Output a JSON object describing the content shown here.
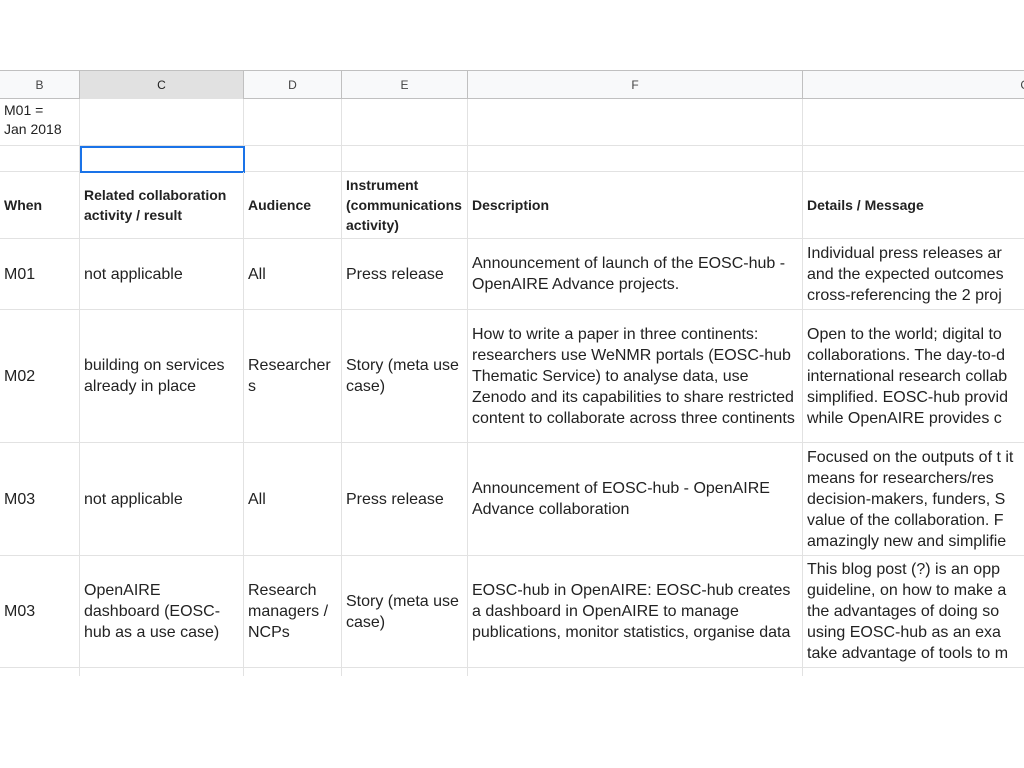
{
  "columns": [
    {
      "letter": "B"
    },
    {
      "letter": "C"
    },
    {
      "letter": "D"
    },
    {
      "letter": "E"
    },
    {
      "letter": "F"
    },
    {
      "letter": "G"
    }
  ],
  "top_note": "M01 =\nJan 2018",
  "headers": {
    "when": "When",
    "related": "Related collaboration activity / result",
    "audience": "Audience",
    "instrument": "Instrument (communications activity)",
    "description": "Description",
    "details": "Details / Message"
  },
  "rows": [
    {
      "when": "M01",
      "related": "not applicable",
      "audience": "All",
      "instrument": "Press release",
      "description": "Announcement of launch of the EOSC-hub - OpenAIRE Advance projects.",
      "details": "Individual press releases ar and the expected outcomes cross-referencing the 2 proj"
    },
    {
      "when": "M02",
      "related": "building on services already in place",
      "audience": "Researchers",
      "instrument": "Story (meta use case)",
      "description": "How to write a paper in three continents: researchers use WeNMR portals (EOSC-hub Thematic Service) to analyse data, use Zenodo and its capabilities to share restricted content to collaborate across three continents",
      "details": "Open to the world; digital to collaborations. The day-to-d international research collab simplified. EOSC-hub provid while OpenAIRE provides c"
    },
    {
      "when": "M03",
      "related": "not applicable",
      "audience": "All",
      "instrument": "Press release",
      "description": "Announcement of EOSC-hub - OpenAIRE Advance collaboration",
      "details": "Focused on the outputs of t it means for researchers/res decision-makers, funders, S value of the collaboration. F amazingly new and simplifie"
    },
    {
      "when": "M03",
      "related": "OpenAIRE dashboard (EOSC-hub as a use case)",
      "audience": "Research managers / NCPs",
      "instrument": "Story (meta use case)",
      "description": "EOSC-hub in OpenAIRE: EOSC-hub creates a dashboard in OpenAIRE to manage publications, monitor statistics, organise data",
      "details": "This blog post (?) is an opp guideline, on how to make a the advantages of doing so using EOSC-hub as an exa take advantage of tools to m"
    }
  ]
}
